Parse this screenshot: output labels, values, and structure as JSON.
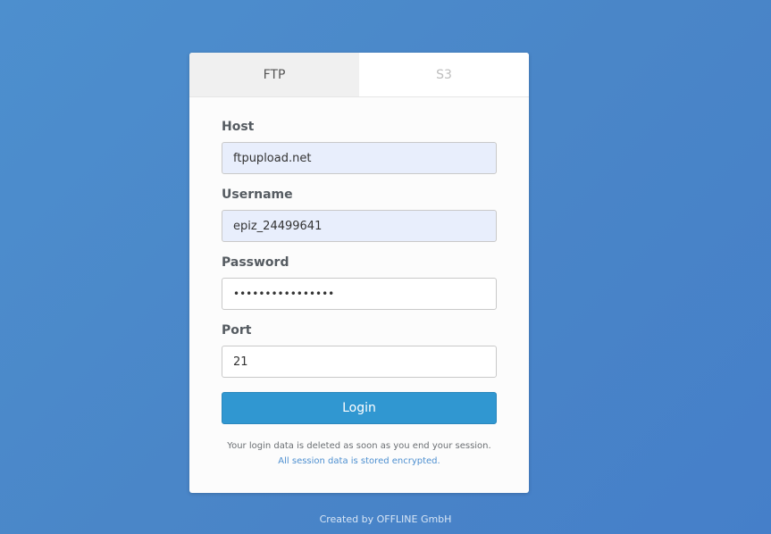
{
  "tabs": {
    "ftp_label": "FTP",
    "s3_label": "S3",
    "active": "FTP"
  },
  "form": {
    "host": {
      "label": "Host",
      "value": "ftpupload.net"
    },
    "username": {
      "label": "Username",
      "value": "epiz_24499641"
    },
    "password": {
      "label": "Password",
      "value": "••••••••••••••••"
    },
    "port": {
      "label": "Port",
      "value": "21"
    },
    "login_label": "Login"
  },
  "notice": {
    "line1": "Your login data is deleted as soon as you end your session.",
    "line2": "All session data is stored encrypted."
  },
  "footer": {
    "credit": "Created by OFFLINE GmbH"
  },
  "colors": {
    "background": "#4a86c8",
    "accent": "#3097d1",
    "link": "#4d8fd0",
    "autofill": "#e8eefc"
  }
}
